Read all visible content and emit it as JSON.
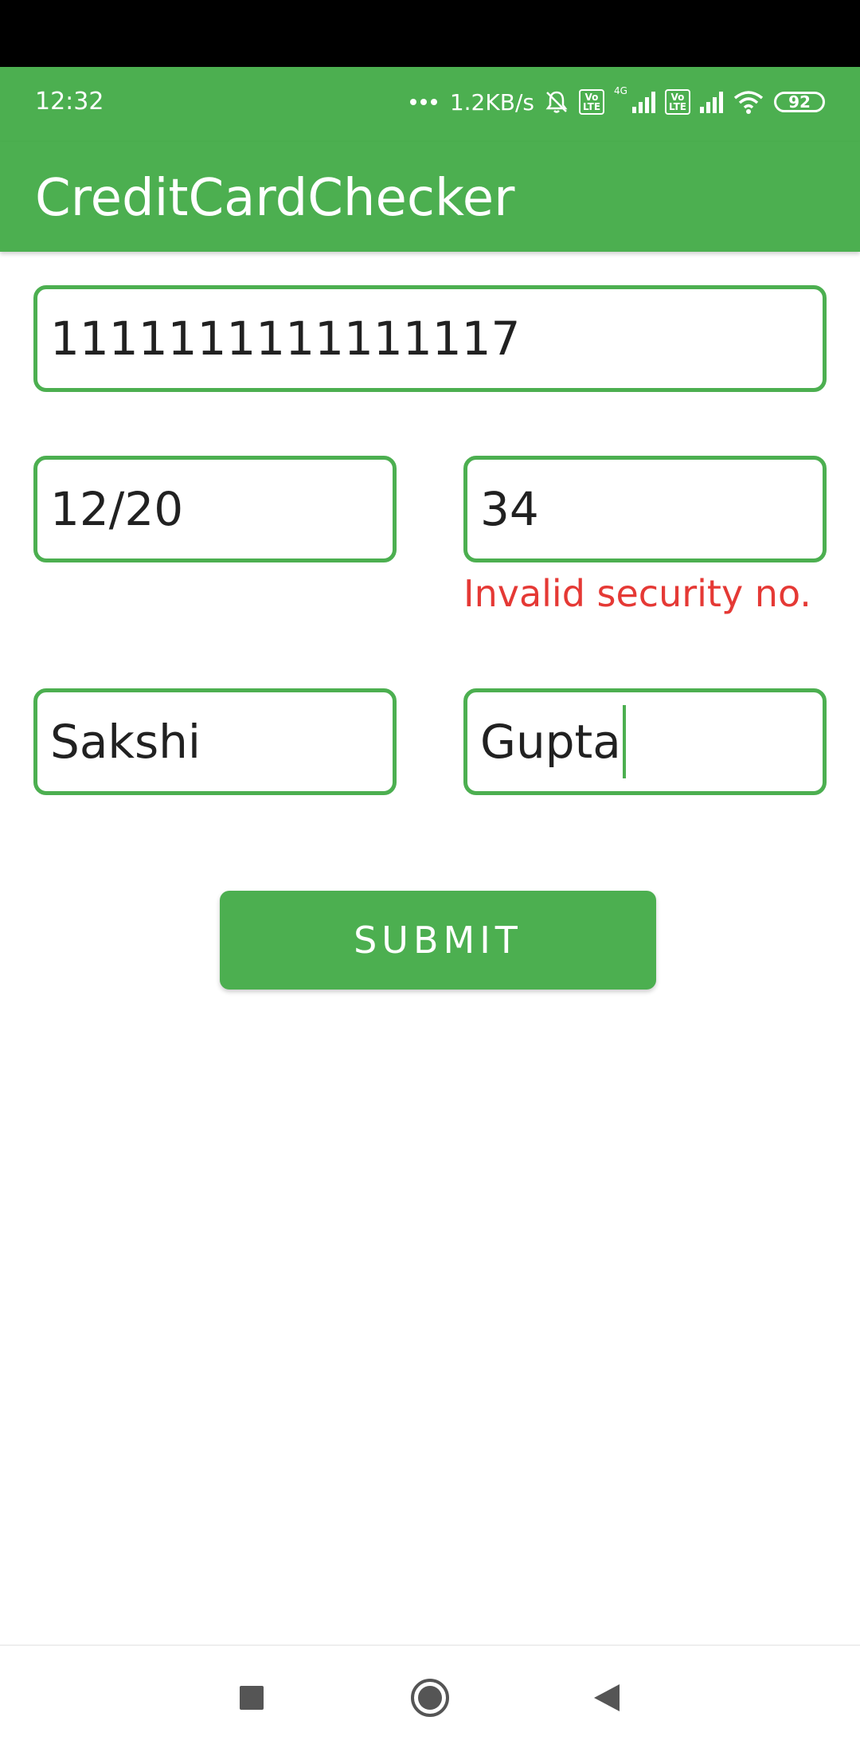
{
  "status_bar": {
    "time": "12:32",
    "net_speed": "1.2KB/s",
    "volte_label_1": "Vo\nLTE",
    "volte_label_2": "Vo\nLTE",
    "network_type": "4G",
    "battery_level": "92",
    "icons": [
      "more-dots-icon",
      "mute-icon",
      "volte-icon",
      "signal-icon",
      "volte-icon",
      "signal-icon",
      "wifi-icon",
      "battery-icon"
    ]
  },
  "app_bar": {
    "title": "CreditCardChecker"
  },
  "form": {
    "card_number": "1111111111111117",
    "expiry": "12/20",
    "security_code": "34",
    "security_error": "Invalid security no.",
    "first_name": "Sakshi",
    "last_name": "Gupta",
    "submit_label": "SUBMIT"
  },
  "nav_bar": {
    "icons": [
      "recents-icon",
      "home-icon",
      "back-icon"
    ]
  },
  "colors": {
    "accent": "#4CAF50",
    "error": "#E53935",
    "text": "#212121"
  }
}
